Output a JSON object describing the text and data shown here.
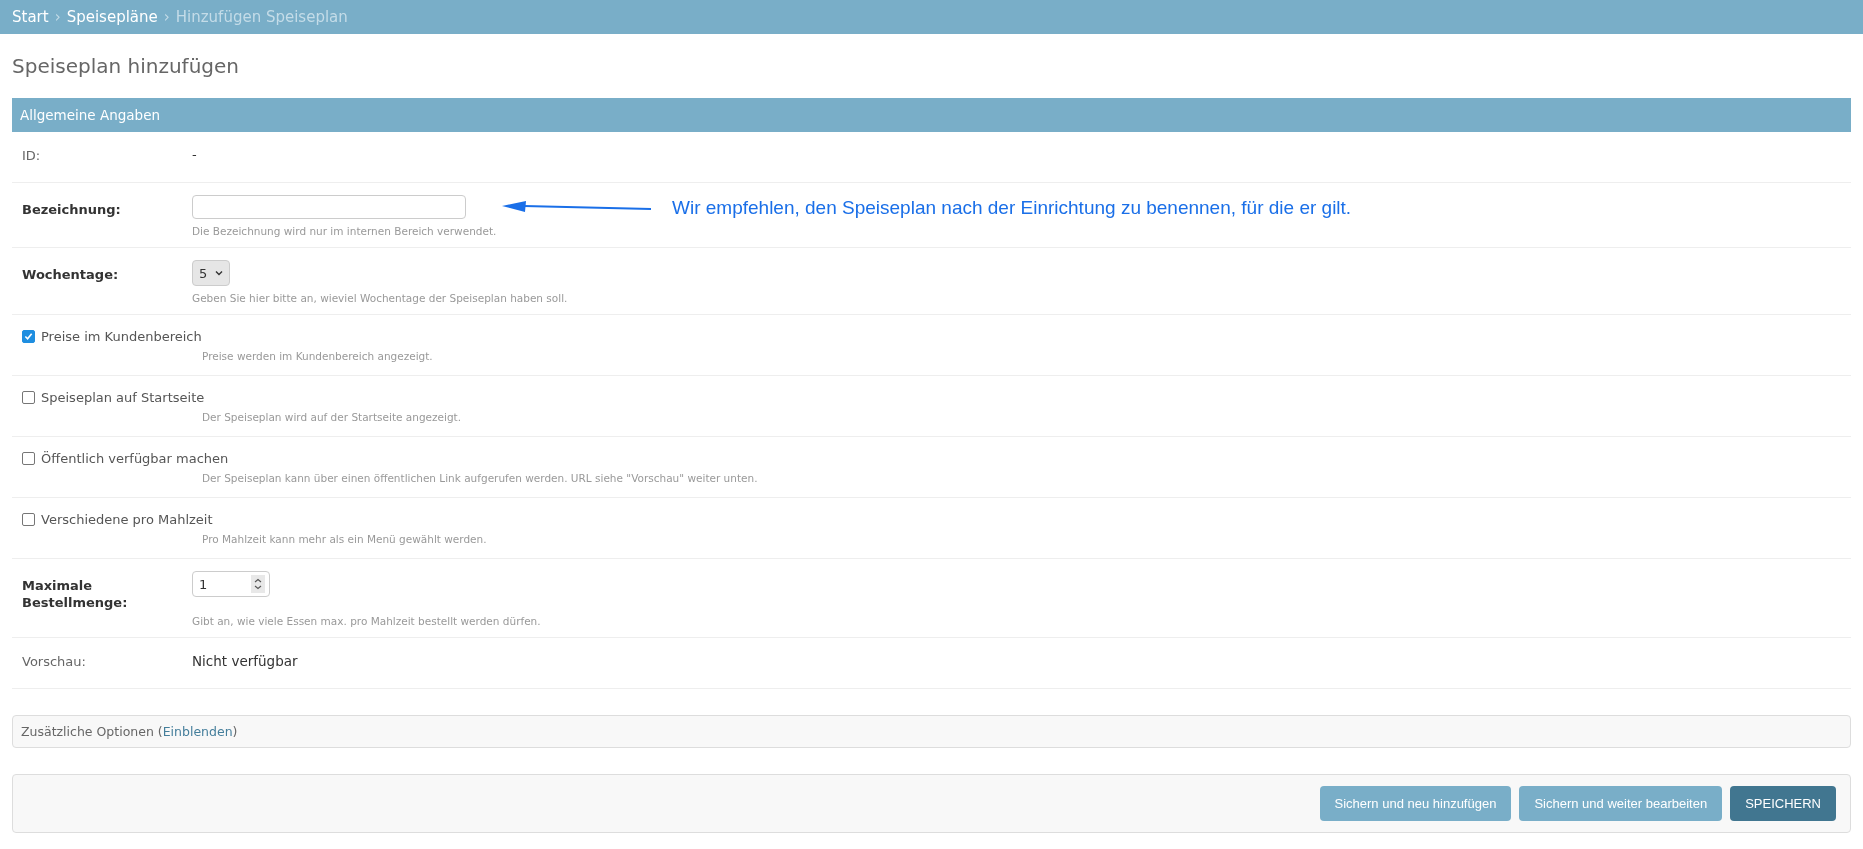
{
  "breadcrumbs": [
    {
      "label": "Start",
      "kind": "link"
    },
    {
      "label": "Speisepläne",
      "kind": "link",
      "separator_before": "›"
    },
    {
      "label": "Hinzufügen Speiseplan",
      "kind": "current",
      "separator_before": "›"
    }
  ],
  "title": "Speiseplan hinzufügen",
  "fieldset": {
    "heading": "Allgemeine Angaben",
    "rows": [
      {
        "kind": "readonly",
        "label": "ID:",
        "value": "-"
      },
      {
        "kind": "text",
        "label": "Bezeichnung:",
        "help": "Die Bezeichnung wird nur im internen Bereich verwendet.",
        "annotation": "Wir empfehlen, den Speiseplan nach der Einrichtung zu benennen, für die er gilt."
      },
      {
        "kind": "select",
        "label": "Wochentage:",
        "value": "5",
        "help": "Geben Sie hier bitte an, wieviel Wochentage der Speiseplan haben soll."
      },
      {
        "kind": "checkbox",
        "label": "Preise im Kundenbereich",
        "checked": true,
        "help": "Preise werden im Kundenbereich angezeigt."
      },
      {
        "kind": "checkbox",
        "label": "Speiseplan auf Startseite",
        "checked": false,
        "help": "Der Speiseplan wird auf der Startseite angezeigt."
      },
      {
        "kind": "checkbox",
        "label": "Öffentlich verfügbar machen",
        "checked": false,
        "help": "Der Speiseplan kann über einen öffentlichen Link aufgerufen werden. URL siehe \"Vorschau\" weiter unten."
      },
      {
        "kind": "checkbox",
        "label": "Verschiedene pro Mahlzeit",
        "checked": false,
        "help": "Pro Mahlzeit kann mehr als ein Menü gewählt werden."
      },
      {
        "kind": "number",
        "label": "Maximale Bestellmenge:",
        "value": "1",
        "help": "Gibt an, wie viele Essen max. pro Mahlzeit bestellt werden dürfen."
      },
      {
        "kind": "readonly",
        "label": "Vorschau:",
        "value": "Nicht verfügbar"
      }
    ]
  },
  "extra": {
    "prefix": "Zusätzliche Optionen (",
    "link": "Einblenden",
    "suffix": ")"
  },
  "buttons": [
    {
      "label": "Sichern und neu hinzufügen",
      "kind": "secondary"
    },
    {
      "label": "Sichern und weiter bearbeiten",
      "kind": "secondary"
    },
    {
      "label": "SPEICHERN",
      "kind": "primary"
    }
  ]
}
